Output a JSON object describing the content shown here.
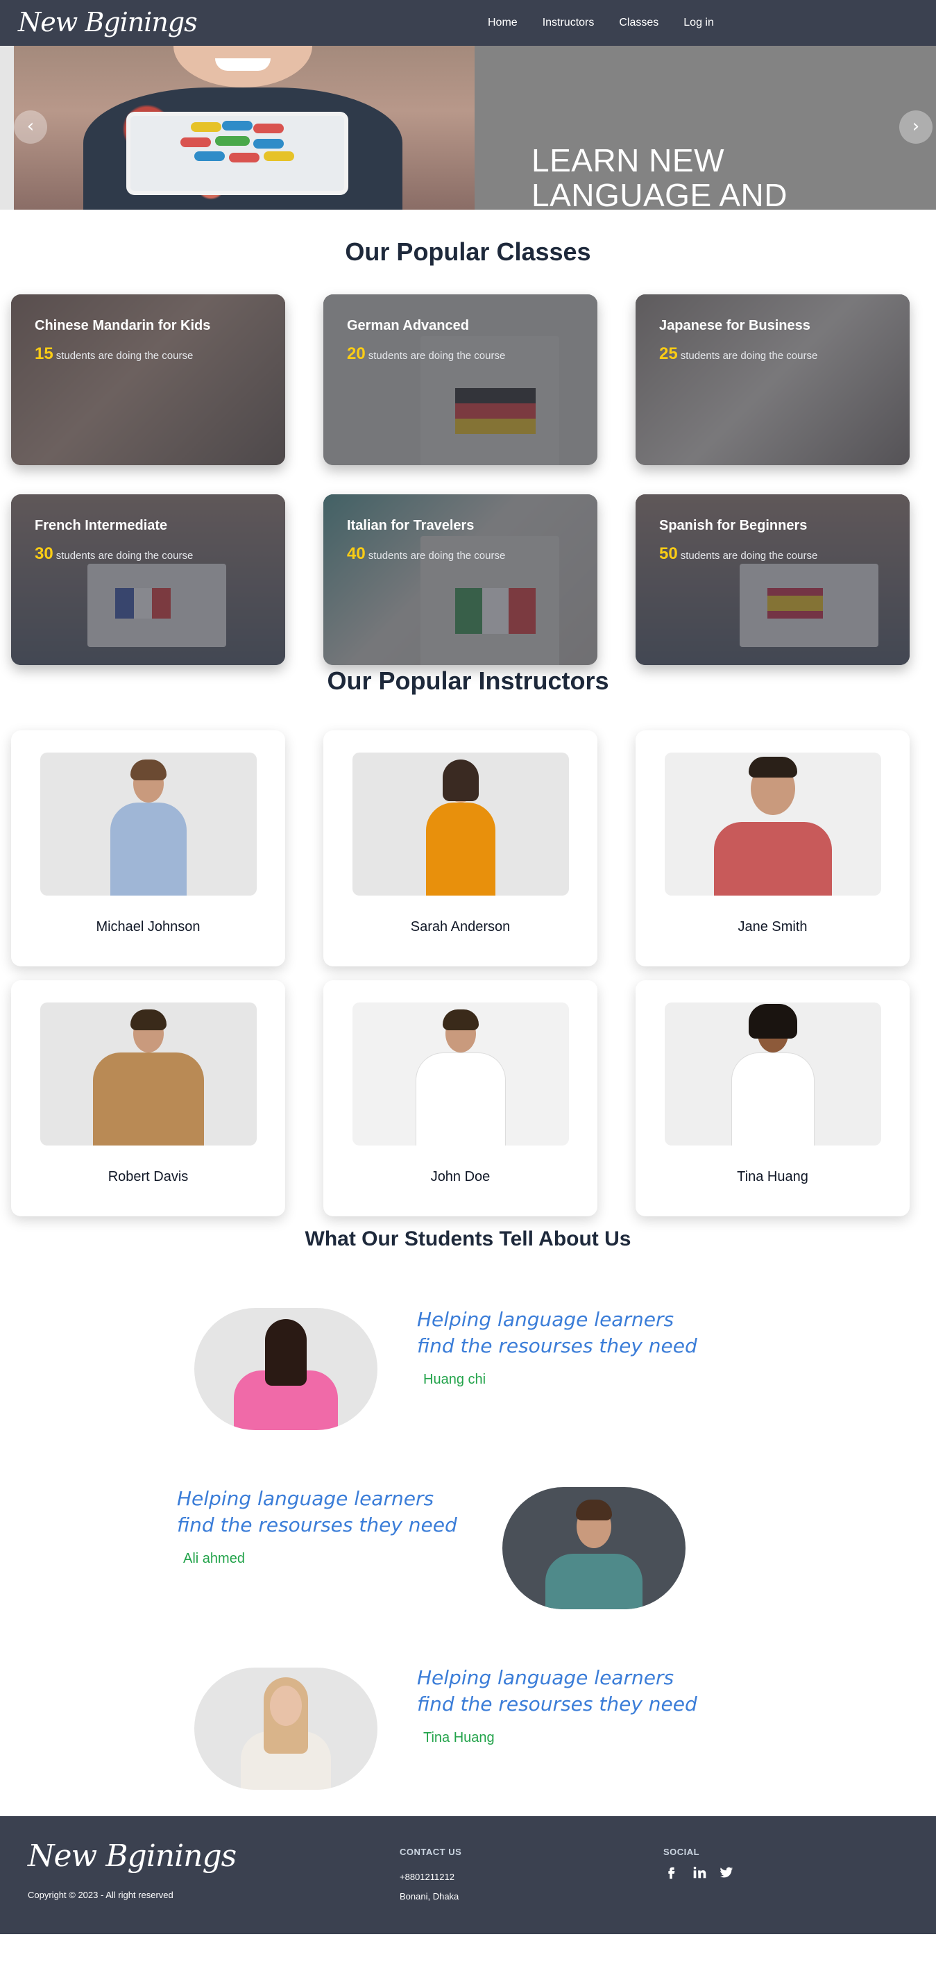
{
  "navbar": {
    "logo": "New Bginings",
    "links": [
      "Home",
      "Instructors",
      "Classes",
      "Log in"
    ]
  },
  "hero": {
    "title_line1": "LEARN NEW",
    "title_line2": "LANGUAGE AND",
    "prev_symbol": "‹",
    "next_symbol": "›"
  },
  "classes": {
    "title": "Our Popular Classes",
    "suffix": "students are doing the course",
    "items": [
      {
        "name": "Chinese Mandarin for Kids",
        "count": "15"
      },
      {
        "name": "German Advanced",
        "count": "20",
        "flag_label": "Learn German"
      },
      {
        "name": "Japanese for Business",
        "count": "25"
      },
      {
        "name": "French Intermediate",
        "count": "30",
        "flag_label": "Learn French"
      },
      {
        "name": "Italian for Travelers",
        "count": "40",
        "flag_label": "Learn Italian"
      },
      {
        "name": "Spanish for Beginners",
        "count": "50",
        "flag_label": "Learn Spanish"
      }
    ]
  },
  "instructors": {
    "title": "Our Popular Instructors",
    "items": [
      {
        "name": "Michael Johnson"
      },
      {
        "name": "Sarah Anderson"
      },
      {
        "name": "Jane Smith"
      },
      {
        "name": "Robert Davis"
      },
      {
        "name": "John Doe"
      },
      {
        "name": "Tina Huang"
      }
    ]
  },
  "testimonials": {
    "title": "What Our Students Tell About Us",
    "items": [
      {
        "quote_line1": "Helping language learners",
        "quote_line2": "find the resourses they need",
        "name": "Huang chi"
      },
      {
        "quote_line1": "Helping language learners",
        "quote_line2": "find the resourses they need",
        "name": "Ali ahmed"
      },
      {
        "quote_line1": "Helping language learners",
        "quote_line2": "find the resourses they need",
        "name": "Tina Huang"
      }
    ]
  },
  "footer": {
    "logo": "New Bginings",
    "copyright": "Copyright © 2023 - All right reserved",
    "contact_heading": "CONTACT US",
    "phone": "+8801211212",
    "address": "Bonani, Dhaka",
    "social_heading": "SOCIAL",
    "social_icons": [
      "facebook-icon",
      "linkedin-icon",
      "twitter-icon"
    ]
  },
  "colors": {
    "nav_bg": "#3b4150",
    "count_yellow": "#facc15",
    "quote_blue": "#3b7dd8",
    "name_green": "#22a34a"
  }
}
